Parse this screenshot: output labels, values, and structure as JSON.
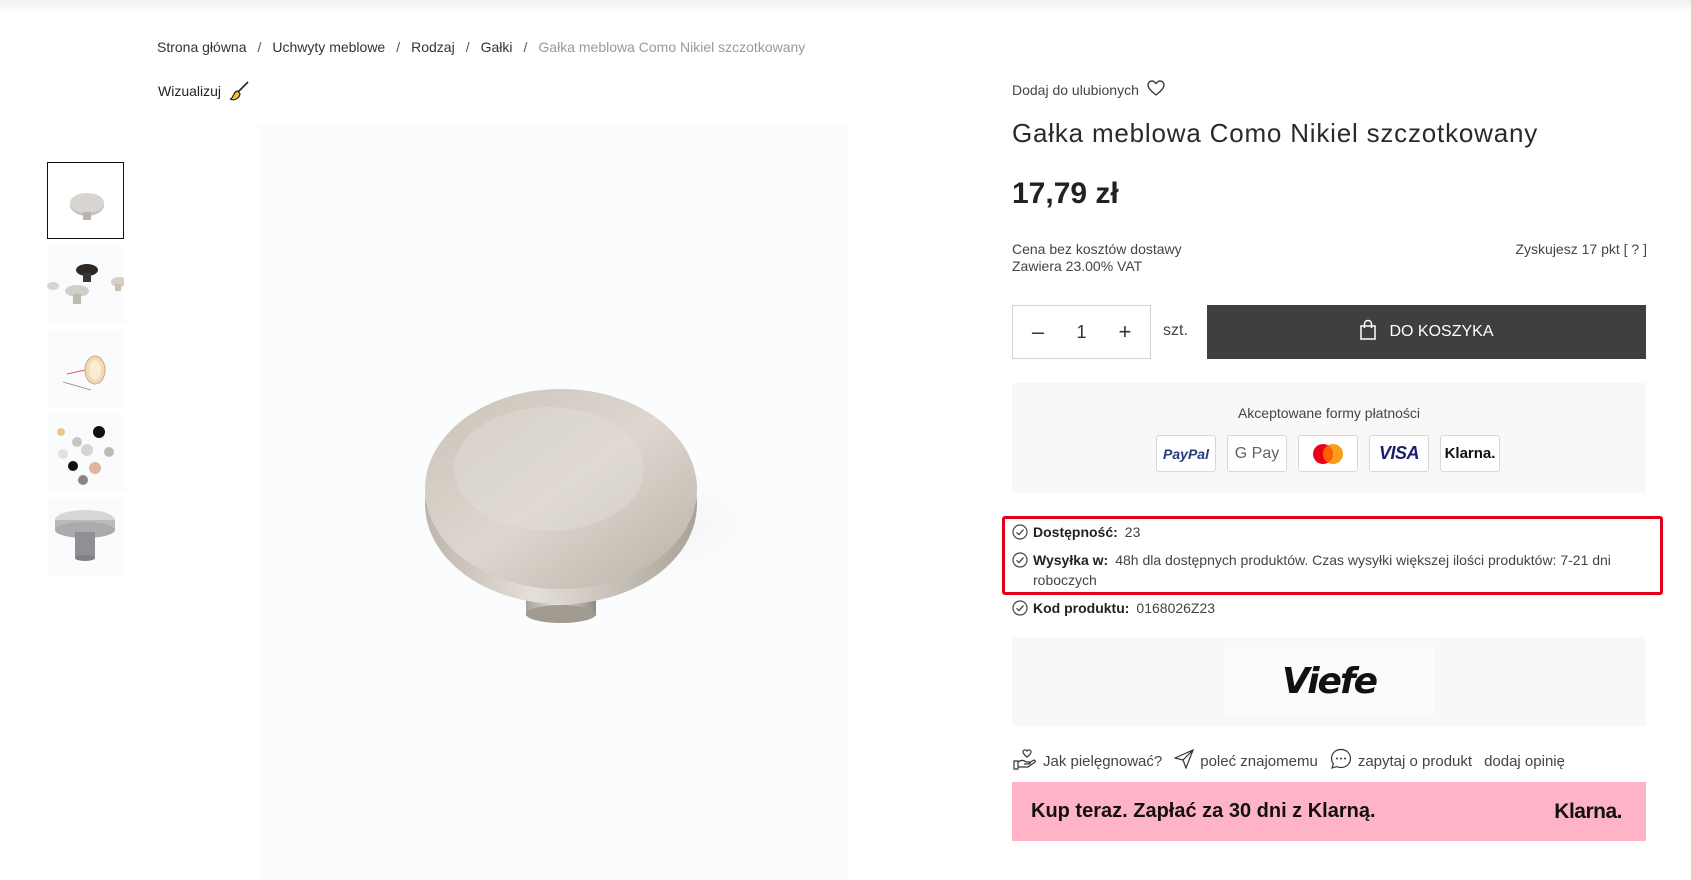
{
  "breadcrumb": [
    {
      "label": "Strona główna"
    },
    {
      "label": "Uchwyty meblowe"
    },
    {
      "label": "Rodzaj"
    },
    {
      "label": "Gałki"
    },
    {
      "label": "Gałka meblowa Como Nikiel szczotkowany"
    }
  ],
  "breadcrumb_separator": "/",
  "visualize_label": "Wizualizuj",
  "favorites_label": "Dodaj do ulubionych",
  "product": {
    "title": "Gałka meblowa Como Nikiel szczotkowany",
    "price": "17,79 zł",
    "price_note_line1": "Cena bez kosztów dostawy",
    "price_note_line2": "Zawiera 23.00% VAT",
    "points_text": "Zyskujesz 17 pkt",
    "points_help": "[ ? ]"
  },
  "quantity": {
    "minus": "–",
    "value": "1",
    "plus": "+",
    "unit": "szt."
  },
  "cart_button_label": "DO KOSZYKA",
  "payments": {
    "title": "Akceptowane formy płatności",
    "methods": [
      "PayPal",
      "G Pay",
      "Mastercard",
      "VISA",
      "Klarna."
    ]
  },
  "availability": {
    "label": "Dostępność:",
    "value": "23"
  },
  "shipping": {
    "label": "Wysyłka w:",
    "value": "48h dla dostępnych produktów. Czas wysyłki większej ilości produktów: 7-21 dni roboczych"
  },
  "product_code": {
    "label": "Kod produktu:",
    "value": "0168026Z23"
  },
  "brand_logo_text": "Viefe",
  "actions": {
    "care": "Jak pielęgnować?",
    "recommend": "poleć znajomemu",
    "ask": "zapytaj o produkt",
    "review": "dodaj opinię"
  },
  "klarna_banner": {
    "text": "Kup teraz. Zapłać za 30 dni z Klarną.",
    "logo": "Klarna."
  },
  "colors": {
    "cart_button": "#3f3f3f",
    "klarna_pink": "#ffb3c7",
    "highlight_red": "#e2001a"
  }
}
